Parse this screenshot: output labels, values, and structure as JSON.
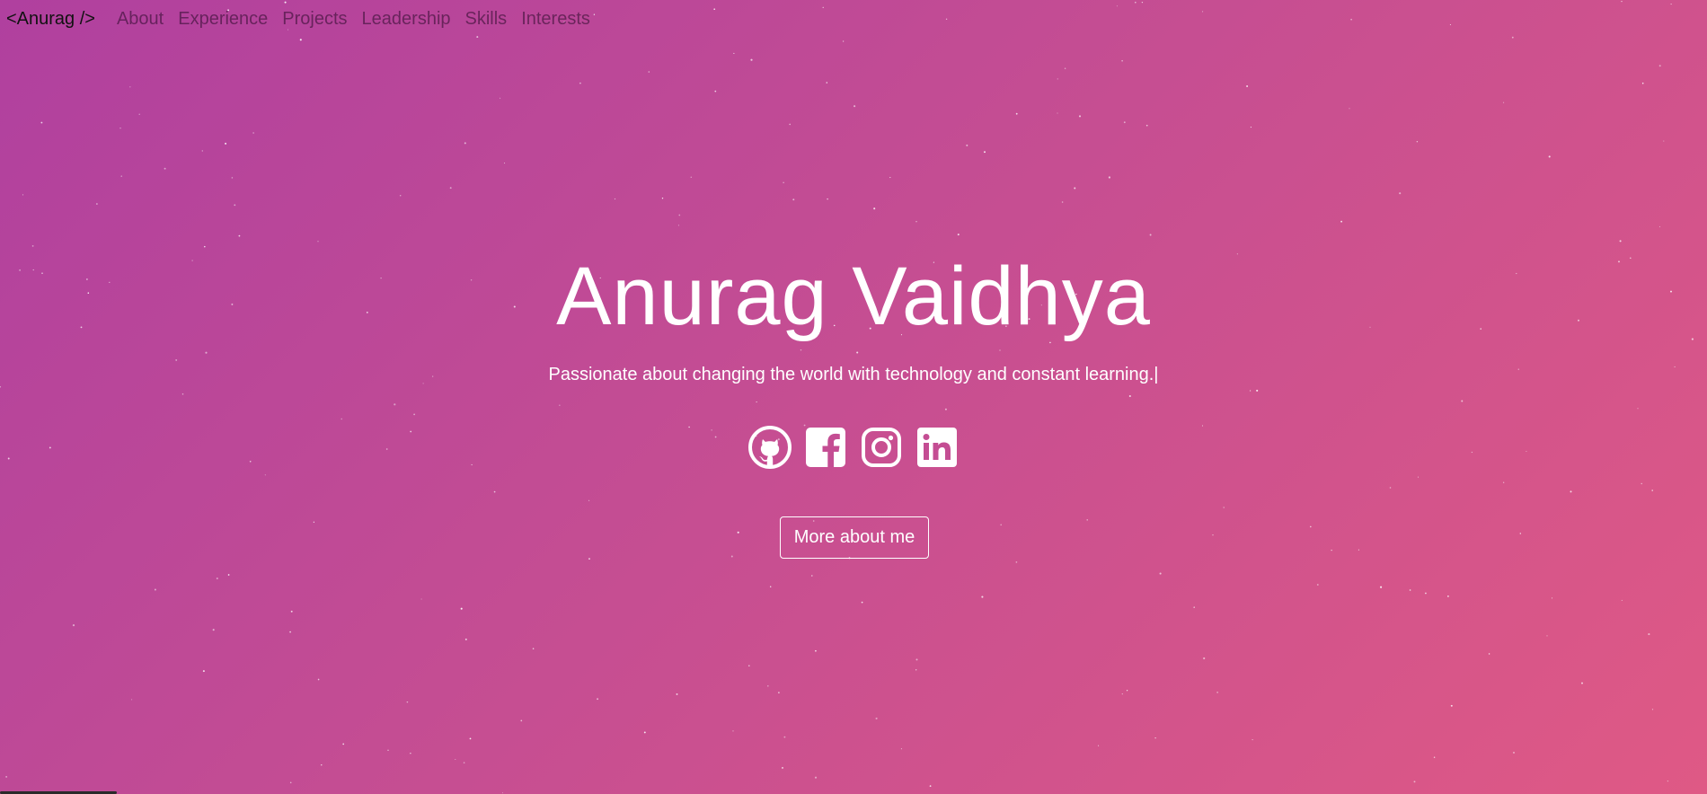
{
  "nav": {
    "brand": "<Anurag />",
    "links": [
      "About",
      "Experience",
      "Projects",
      "Leadership",
      "Skills",
      "Interests"
    ]
  },
  "hero": {
    "title": "Anurag Vaidhya",
    "subtitle": "Passionate about changing the world with technology and constant learning.|"
  },
  "social": [
    {
      "icon": "github-icon"
    },
    {
      "icon": "facebook-icon"
    },
    {
      "icon": "instagram-icon"
    },
    {
      "icon": "linkedin-icon"
    }
  ],
  "cta": {
    "label": "More about me"
  },
  "colors": {
    "gradient_start": "#b0409f",
    "gradient_end": "#df5985",
    "text": "#ffffff"
  }
}
